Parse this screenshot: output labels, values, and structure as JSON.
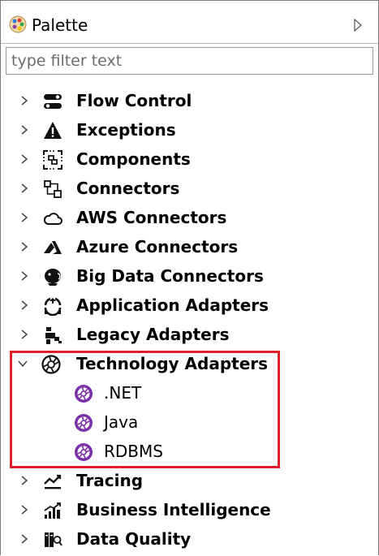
{
  "palette": {
    "title": "Palette",
    "filter_placeholder": "type filter text",
    "highlight_color": "#e0202a",
    "items": [
      {
        "label": "Flow Control",
        "icon": "flow-control-icon",
        "expanded": false
      },
      {
        "label": "Exceptions",
        "icon": "exceptions-icon",
        "expanded": false
      },
      {
        "label": "Components",
        "icon": "components-icon",
        "expanded": false
      },
      {
        "label": "Connectors",
        "icon": "connectors-icon",
        "expanded": false
      },
      {
        "label": "AWS Connectors",
        "icon": "aws-cloud-icon",
        "expanded": false
      },
      {
        "label": "Azure Connectors",
        "icon": "azure-icon",
        "expanded": false
      },
      {
        "label": "Big Data Connectors",
        "icon": "big-data-icon",
        "expanded": false
      },
      {
        "label": "Application Adapters",
        "icon": "application-adapters-icon",
        "expanded": false
      },
      {
        "label": "Legacy Adapters",
        "icon": "legacy-adapters-icon",
        "expanded": false
      },
      {
        "label": "Technology Adapters",
        "icon": "technology-adapters-icon",
        "expanded": true,
        "children": [
          {
            "label": ".NET",
            "icon": "aperture-icon"
          },
          {
            "label": "Java",
            "icon": "aperture-icon"
          },
          {
            "label": "RDBMS",
            "icon": "aperture-icon"
          }
        ]
      },
      {
        "label": "Tracing",
        "icon": "tracing-icon",
        "expanded": false
      },
      {
        "label": "Business Intelligence",
        "icon": "business-intelligence-icon",
        "expanded": false
      },
      {
        "label": "Data Quality",
        "icon": "data-quality-icon",
        "expanded": false
      }
    ]
  }
}
